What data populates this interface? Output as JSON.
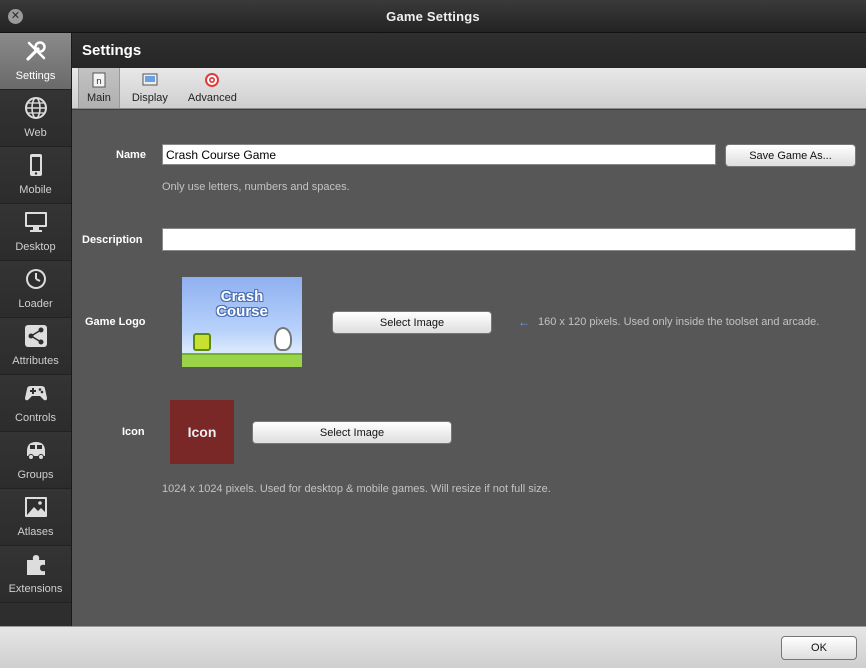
{
  "window": {
    "title": "Game Settings",
    "close_glyph": "✕"
  },
  "sidebar": {
    "items": [
      {
        "label": "Settings",
        "icon": "wrench-icon",
        "active": true
      },
      {
        "label": "Web",
        "icon": "globe-icon"
      },
      {
        "label": "Mobile",
        "icon": "phone-icon"
      },
      {
        "label": "Desktop",
        "icon": "monitor-icon"
      },
      {
        "label": "Loader",
        "icon": "clock-icon"
      },
      {
        "label": "Attributes",
        "icon": "share-icon"
      },
      {
        "label": "Controls",
        "icon": "gamepad-icon"
      },
      {
        "label": "Groups",
        "icon": "car-icon"
      },
      {
        "label": "Atlases",
        "icon": "image-icon"
      },
      {
        "label": "Extensions",
        "icon": "puzzle-icon"
      }
    ]
  },
  "header": {
    "title": "Settings"
  },
  "tabs": [
    {
      "label": "Main",
      "active": true,
      "icon": "main-tab-icon"
    },
    {
      "label": "Display",
      "icon": "display-tab-icon"
    },
    {
      "label": "Advanced",
      "icon": "target-icon"
    }
  ],
  "form": {
    "name_label": "Name",
    "name_value": "Crash Course Game",
    "save_as_label": "Save Game As...",
    "name_hint": "Only use letters, numbers and spaces.",
    "description_label": "Description",
    "description_value": "",
    "logo_label": "Game Logo",
    "logo_title_line1": "Crash",
    "logo_title_line2": "Course",
    "logo_select_label": "Select Image",
    "logo_hint": "160 x 120 pixels. Used only inside the toolset and arcade.",
    "icon_label": "Icon",
    "icon_text": "Icon",
    "icon_select_label": "Select Image",
    "icon_hint": "1024 x 1024 pixels. Used for desktop & mobile games. Will resize if not full size."
  },
  "footer": {
    "ok_label": "OK"
  },
  "colors": {
    "panel": "#575757",
    "sidebar": "#2e2e2e",
    "icon_bg": "#7a2727",
    "hint_arrow": "#5aa9ff"
  }
}
